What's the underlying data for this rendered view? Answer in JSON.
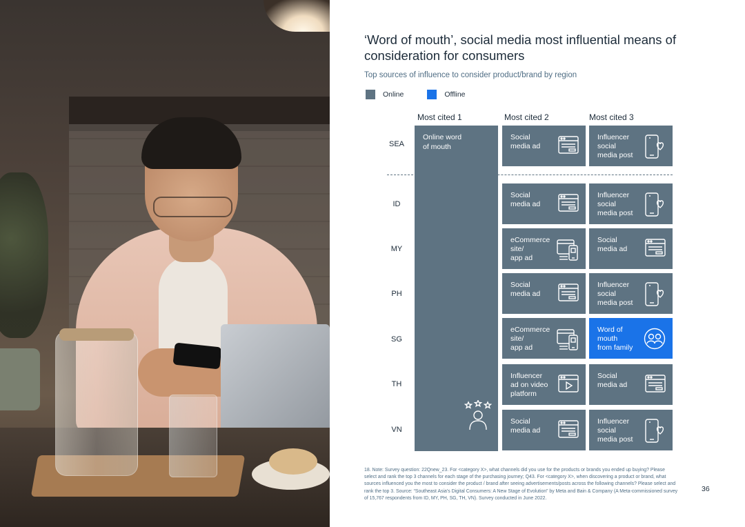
{
  "title": "‘Word of mouth’, social media most influential means of consideration for consumers",
  "subtitle": "Top sources of influence to consider product/brand by region",
  "legend": [
    {
      "label": "Online",
      "color": "#5e7382"
    },
    {
      "label": "Offline",
      "color": "#1a73e8"
    }
  ],
  "columns": [
    "Most cited 1",
    "Most cited 2",
    "Most cited 3"
  ],
  "rows": [
    "SEA",
    "ID",
    "MY",
    "PH",
    "SG",
    "TH",
    "VN"
  ],
  "most_cited_1": {
    "label": "Online word\nof mouth",
    "icon": "people-stars-icon"
  },
  "cells": {
    "sea": [
      {
        "label": "Social\nmedia ad",
        "icon": "browser-ad-icon",
        "type": "online"
      },
      {
        "label": "Influencer\nsocial\nmedia post",
        "icon": "phone-heart-icon",
        "type": "online"
      }
    ],
    "id": [
      {
        "label": "Social\nmedia ad",
        "icon": "browser-ad-icon",
        "type": "online"
      },
      {
        "label": "Influencer\nsocial\nmedia post",
        "icon": "phone-heart-icon",
        "type": "online"
      }
    ],
    "my": [
      {
        "label": "eCommerce\nsite/\napp ad",
        "icon": "ecommerce-devices-icon",
        "type": "online"
      },
      {
        "label": "Social\nmedia ad",
        "icon": "browser-ad-icon",
        "type": "online"
      }
    ],
    "ph": [
      {
        "label": "Social\nmedia ad",
        "icon": "browser-ad-icon",
        "type": "online"
      },
      {
        "label": "Influencer\nsocial\nmedia post",
        "icon": "phone-heart-icon",
        "type": "online"
      }
    ],
    "sg": [
      {
        "label": "eCommerce\nsite/\napp ad",
        "icon": "ecommerce-devices-icon",
        "type": "online"
      },
      {
        "label": "Word of\nmouth\nfrom family",
        "icon": "family-icon",
        "type": "offline"
      }
    ],
    "th": [
      {
        "label": "Influencer\nad on video\nplatform",
        "icon": "video-player-icon",
        "type": "online"
      },
      {
        "label": "Social\nmedia ad",
        "icon": "browser-ad-icon",
        "type": "online"
      }
    ],
    "vn": [
      {
        "label": "Social\nmedia ad",
        "icon": "browser-ad-icon",
        "type": "online"
      },
      {
        "label": "Influencer\nsocial\nmedia post",
        "icon": "phone-heart-icon",
        "type": "online"
      }
    ]
  },
  "footnote": "18. Note: Survey question: 22Qnew_23. For <category X>, what channels did you use for the products or brands you ended up buying? Please select and rank the top 3 channels for each stage of the purchasing journey; Q43. For <category X>, when discovering a product or brand, what sources influenced you the most to consider the product / brand after seeing advertisements/posts across the following channels? Please select and rank the top 3. Source: “Southeast Asia’s Digital Consumers: A New Stage of Evolution” by Meta and Bain & Company (A Meta-commissioned survey of 15,767 respondents from ID, MY, PH, SG, TH, VN). Survey conducted in June 2022.",
  "page_number": "36"
}
